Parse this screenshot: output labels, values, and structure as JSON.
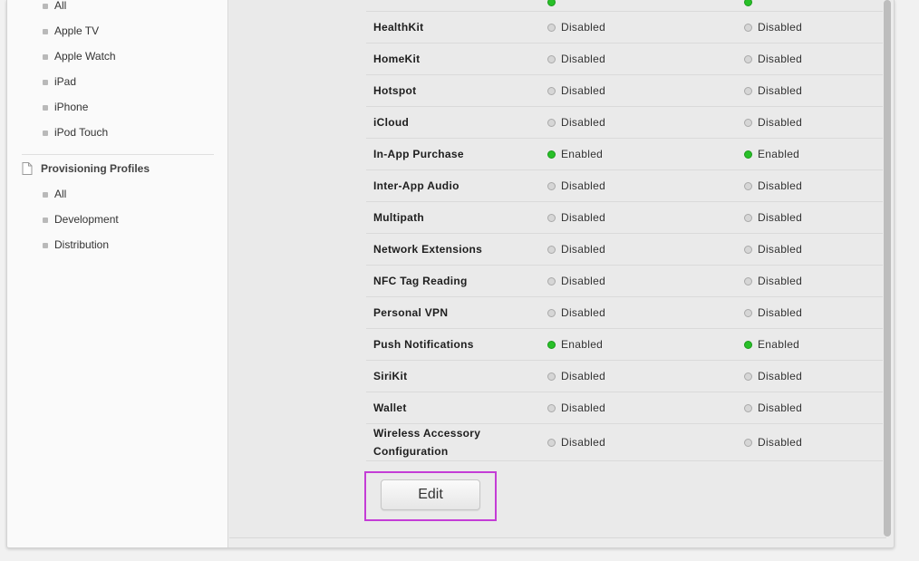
{
  "sidebar": {
    "device_items": [
      {
        "label": "All"
      },
      {
        "label": "Apple TV"
      },
      {
        "label": "Apple Watch"
      },
      {
        "label": "iPad"
      },
      {
        "label": "iPhone"
      },
      {
        "label": "iPod Touch"
      }
    ],
    "profiles_section": {
      "title": "Provisioning Profiles",
      "icon": "document-icon",
      "items": [
        {
          "label": "All"
        },
        {
          "label": "Development"
        },
        {
          "label": "Distribution"
        }
      ]
    }
  },
  "capabilities": [
    {
      "name": "HealthKit",
      "development": "Disabled",
      "distribution": "Disabled"
    },
    {
      "name": "HomeKit",
      "development": "Disabled",
      "distribution": "Disabled"
    },
    {
      "name": "Hotspot",
      "development": "Disabled",
      "distribution": "Disabled"
    },
    {
      "name": "iCloud",
      "development": "Disabled",
      "distribution": "Disabled"
    },
    {
      "name": "In-App Purchase",
      "development": "Enabled",
      "distribution": "Enabled"
    },
    {
      "name": "Inter-App Audio",
      "development": "Disabled",
      "distribution": "Disabled"
    },
    {
      "name": "Multipath",
      "development": "Disabled",
      "distribution": "Disabled"
    },
    {
      "name": "Network Extensions",
      "development": "Disabled",
      "distribution": "Disabled"
    },
    {
      "name": "NFC Tag Reading",
      "development": "Disabled",
      "distribution": "Disabled"
    },
    {
      "name": "Personal VPN",
      "development": "Disabled",
      "distribution": "Disabled"
    },
    {
      "name": "Push Notifications",
      "development": "Enabled",
      "distribution": "Enabled"
    },
    {
      "name": "SiriKit",
      "development": "Disabled",
      "distribution": "Disabled"
    },
    {
      "name": "Wallet",
      "development": "Disabled",
      "distribution": "Disabled"
    },
    {
      "name": "Wireless Accessory Configuration",
      "development": "Disabled",
      "distribution": "Disabled"
    }
  ],
  "colors": {
    "enabled_dot": "#28c028",
    "disabled_dot": "#d6d6d6",
    "highlight_border": "#c43dd6"
  },
  "edit_button": {
    "label": "Edit"
  }
}
